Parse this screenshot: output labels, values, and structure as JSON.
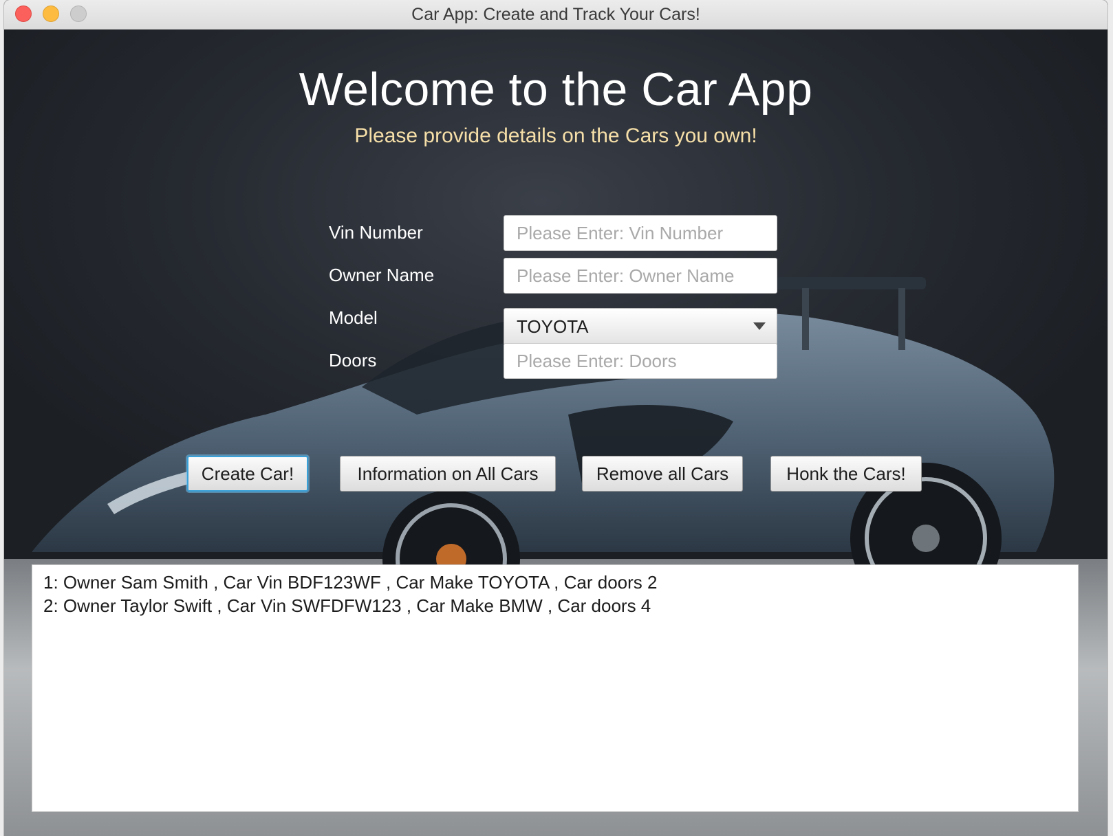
{
  "window": {
    "title": "Car App: Create and Track Your Cars!"
  },
  "header": {
    "title": "Welcome to the Car App",
    "subtitle": "Please provide details on the Cars you own!"
  },
  "form": {
    "vin": {
      "label": "Vin Number",
      "placeholder": "Please Enter: Vin Number",
      "value": ""
    },
    "owner": {
      "label": "Owner Name",
      "placeholder": "Please Enter: Owner Name",
      "value": ""
    },
    "model": {
      "label": "Model",
      "selected": "TOYOTA"
    },
    "doors": {
      "label": "Doors",
      "placeholder": "Please Enter: Doors",
      "value": ""
    }
  },
  "actions": {
    "create": "Create Car!",
    "info": "Information on All Cars",
    "remove": "Remove all Cars",
    "honk": "Honk the Cars!"
  },
  "output": {
    "lines": [
      "1: Owner Sam Smith , Car Vin BDF123WF , Car Make TOYOTA , Car doors 2",
      "2: Owner Taylor Swift , Car Vin SWFDFW123 , Car Make BMW , Car doors 4"
    ]
  },
  "colors": {
    "subtitle": "#f6dfa8",
    "focus_ring": "#3aa1d8",
    "background": "#1f2226"
  }
}
